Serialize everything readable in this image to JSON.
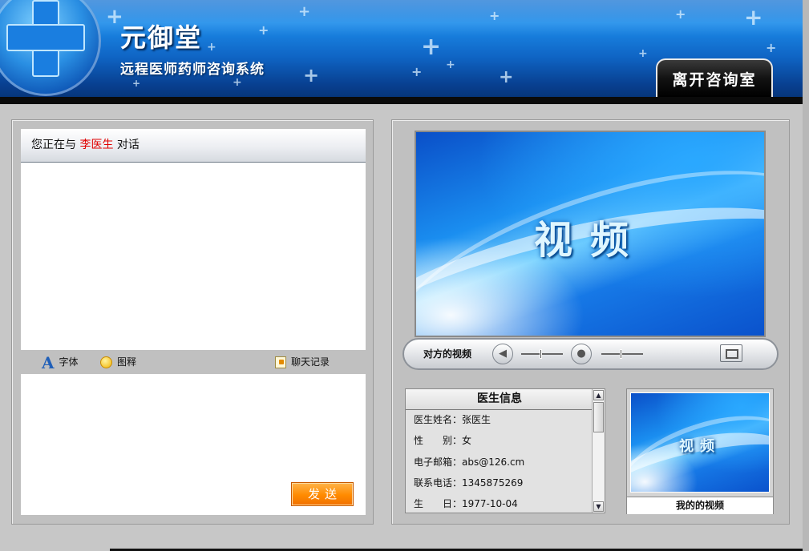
{
  "header": {
    "brand_title": "元御堂",
    "brand_subtitle": "远程医师药师咨询系统",
    "leave_button": "离开咨询室"
  },
  "chat": {
    "header_prefix": "您正在与",
    "doctor_name": "李医生",
    "header_suffix": "对话",
    "toolbar": {
      "font_label": "字体",
      "emoji_label": "图释",
      "history_label": "聊天记录"
    },
    "input_value": "",
    "send_button": "发送"
  },
  "video": {
    "remote_label": "视频",
    "controls_label": "对方的视频",
    "my_video_label": "视频",
    "my_video_caption": "我的的视频"
  },
  "doctor_info": {
    "title": "医生信息",
    "rows": [
      {
        "key": "医生姓名：",
        "value": "张医生"
      },
      {
        "key": "性　　别：",
        "value": "女"
      },
      {
        "key": "电子邮箱：",
        "value": "abs@126.cm"
      },
      {
        "key": "联系电话：",
        "value": "1345875269"
      },
      {
        "key": "生　　日：",
        "value": "1977-10-04"
      }
    ]
  },
  "icons": [
    "logo-cross-icon",
    "font-icon",
    "emoji-icon",
    "history-icon",
    "speaker-icon",
    "microphone-icon",
    "fullscreen-icon"
  ]
}
